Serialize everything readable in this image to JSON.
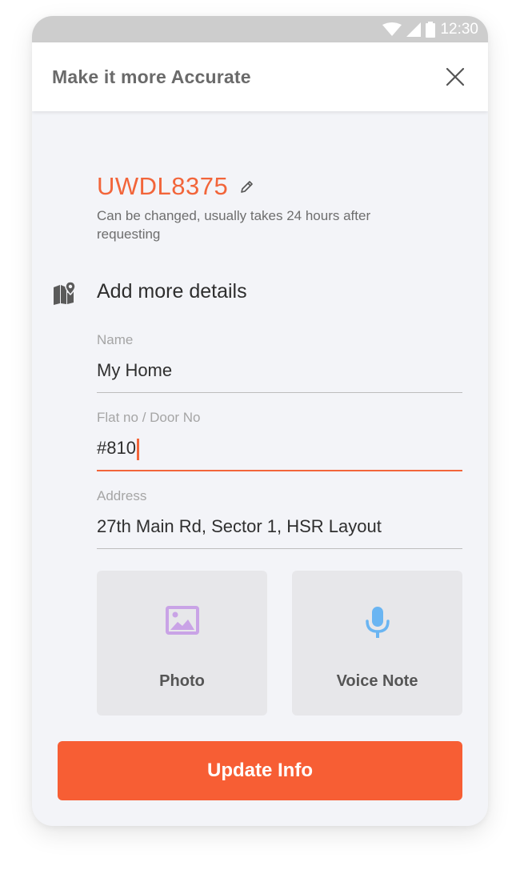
{
  "status_bar": {
    "time": "12:30",
    "icons": [
      "wifi-icon",
      "signal-icon",
      "battery-icon"
    ]
  },
  "header": {
    "title": "Make it more Accurate",
    "close_icon": "close-icon"
  },
  "code": {
    "value": "UWDL8375",
    "edit_icon": "pencil-icon",
    "note": "Can be changed, usually takes 24 hours after requesting"
  },
  "details": {
    "icon": "map-pin-icon",
    "title": "Add more details",
    "fields": [
      {
        "label": "Name",
        "value": "My Home"
      },
      {
        "label": "Flat no / Door No",
        "value": "#810"
      },
      {
        "label": "Address",
        "value": "27th Main Rd, Sector 1, HSR Layout"
      }
    ]
  },
  "attachments": [
    {
      "label": "Photo",
      "icon": "image-icon"
    },
    {
      "label": "Voice Note",
      "icon": "microphone-icon"
    }
  ],
  "action": {
    "label": "Update Info"
  },
  "colors": {
    "accent": "#f2653a",
    "button": "#f75e34",
    "photo_icon": "#c9a3e6",
    "voice_icon": "#6ab5f2",
    "background": "#f3f4f8"
  }
}
